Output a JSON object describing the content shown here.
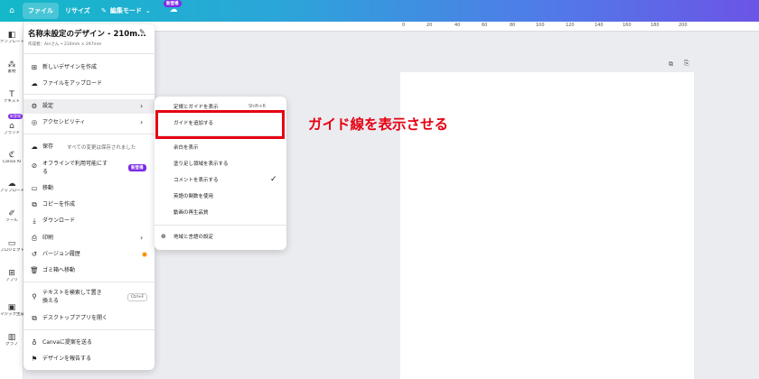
{
  "topbar": {
    "file_tab": "ファイル",
    "resize_tab": "リサイズ",
    "edit_mode": "編集モード",
    "new_badge": "新登場"
  },
  "rail": {
    "items": [
      {
        "label": "テンプレート",
        "icon": "template-icon"
      },
      {
        "label": "素材",
        "icon": "elements-icon"
      },
      {
        "label": "テキスト",
        "icon": "text-icon"
      },
      {
        "label": "ブランド",
        "icon": "brand-icon"
      },
      {
        "label": "Canva AI",
        "icon": "ai-icon"
      },
      {
        "label": "アップロード",
        "icon": "upload-icon"
      },
      {
        "label": "ツール",
        "icon": "tools-icon"
      },
      {
        "label": "プロジェクト",
        "icon": "project-icon"
      },
      {
        "label": "アプリ",
        "icon": "apps-icon"
      },
      {
        "label": "マジック生成",
        "icon": "magic-icon"
      },
      {
        "label": "グラフ",
        "icon": "chart-icon"
      }
    ],
    "new_badge": "新登場"
  },
  "ruler": {
    "ticks": [
      "0",
      "20",
      "40",
      "60",
      "80",
      "100",
      "120",
      "140",
      "160",
      "180",
      "200"
    ]
  },
  "file_menu": {
    "title": "名称未設定のデザイン - 210m...",
    "subtitle": "作成者：Airiさん • 210mm × 297mm",
    "new_design": "新しいデザインを作成",
    "upload_files": "ファイルをアップロード",
    "settings": "設定",
    "accessibility": "アクセシビリティ",
    "save": "保存",
    "save_status": "すべての変更は保存されました",
    "offline_line1": "オフラインで利用可能にす",
    "offline_line2": "る",
    "offline_badge": "新登場",
    "move": "移動",
    "copy": "コピーを作成",
    "download": "ダウンロード",
    "print": "印刷",
    "version_history": "バージョン履歴",
    "trash": "ゴミ箱へ移動",
    "search_line1": "テキストを検索して置き",
    "search_line2": "換える",
    "search_shortcut": "Ctrl+F",
    "desktop_app": "デスクトップアプリを開く",
    "suggest": "Canvaに提案を送る",
    "report": "デザインを報告する"
  },
  "settings_menu": {
    "show_rulers": "定規とガイドを表示",
    "show_rulers_shortcut": "Shift+R",
    "add_guides": "ガイドを追加する",
    "show_margins": "余白を表示",
    "show_bleed": "塗り足し領域を表示する",
    "show_comments": "コメントを表示する",
    "english_functions": "英語の関数を使用",
    "video_quality": "動画の再生品質",
    "region_language": "地域と言語の設定"
  },
  "annotation": {
    "text": "ガイド線を表示させる"
  },
  "colors": {
    "highlight": "#e60012",
    "badge": "#7d2ae8",
    "topbar_start": "#13b8c9",
    "topbar_end": "#6b55e6"
  }
}
